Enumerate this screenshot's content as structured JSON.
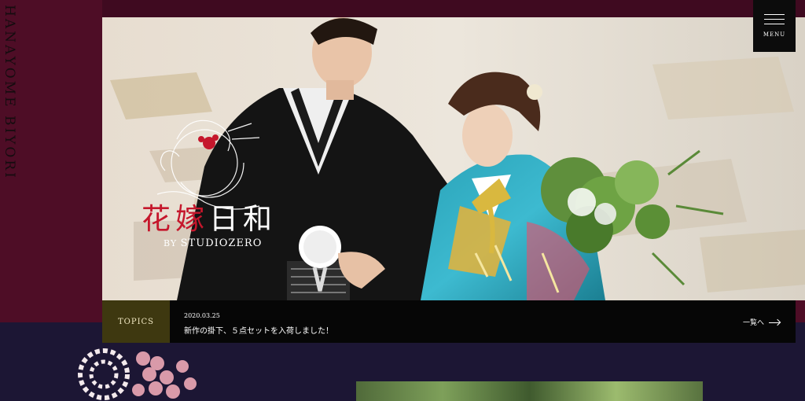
{
  "brand": {
    "vertical_text": "HANAYOME BIYORI",
    "title_part1": "花嫁",
    "title_part2": "日和",
    "by_label": "BY",
    "studio_name": "STUDIOZERO"
  },
  "menu": {
    "label": "MENU"
  },
  "topics": {
    "label": "TOPICS",
    "date": "2020.03.25",
    "text": "新作の掛下、５点セットを入荷しました！",
    "view_all": "一覧へ"
  },
  "colors": {
    "top_band": "#4e0d26",
    "bottom_band": "#1c1634",
    "accent_red": "#c5172c",
    "topics_label_bg": "#3e3810"
  },
  "icons": {
    "menu": "hamburger-icon",
    "arrow": "arrow-right-icon",
    "logo": "crane-plum-emblem-icon"
  }
}
